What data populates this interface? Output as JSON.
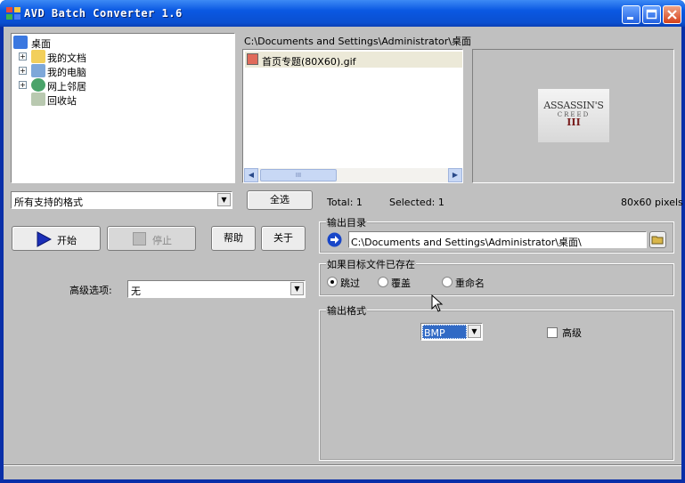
{
  "window": {
    "title": "AVD Batch Converter 1.6"
  },
  "tree": {
    "items": [
      {
        "label": "桌面",
        "icon": "desktop-icon"
      },
      {
        "label": "我的文档",
        "icon": "folder-icon"
      },
      {
        "label": "我的电脑",
        "icon": "computer-icon"
      },
      {
        "label": "网上邻居",
        "icon": "network-icon"
      },
      {
        "label": "回收站",
        "icon": "recycle-bin-icon"
      }
    ]
  },
  "files": {
    "path": "C:\\Documents and Settings\\Administrator\\桌面",
    "items": [
      {
        "name": "首页专题(80X60).gif"
      }
    ],
    "scroll_thumb": "III"
  },
  "preview": {
    "logo_line1": "ASSASSIN'S",
    "logo_line2": "CREED",
    "logo_line3": "III"
  },
  "filter": {
    "value": "所有支持的格式"
  },
  "select_all_label": "全选",
  "status": {
    "total": "Total: 1",
    "selected": "Selected: 1",
    "dimensions": "80x60 pixels"
  },
  "buttons": {
    "start": "开始",
    "stop": "停止",
    "help": "帮助",
    "about": "关于"
  },
  "advanced_options": {
    "label": "高级选项:",
    "value": "无"
  },
  "output_dir": {
    "legend": "输出目录",
    "value": "C:\\Documents and Settings\\Administrator\\桌面\\"
  },
  "if_exists": {
    "legend": "如果目标文件已存在",
    "options": [
      "跳过",
      "覆盖",
      "重命名"
    ],
    "selected": "跳过"
  },
  "output_format": {
    "legend": "输出格式",
    "value": "BMP",
    "advanced_label": "高级",
    "advanced_checked": false
  }
}
